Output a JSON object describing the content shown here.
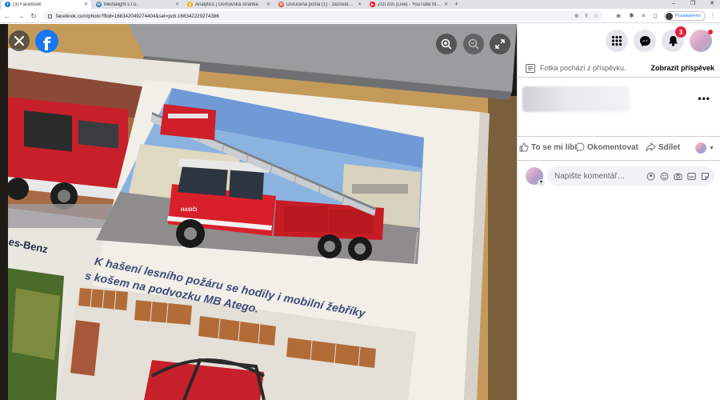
{
  "browser": {
    "tabs": [
      {
        "label": "(3) Facebook",
        "fav_color": "#1877f2",
        "fav_glyph": "f",
        "active": true
      },
      {
        "label": "Medialight s.r.o.",
        "fav_color": "#21759b",
        "fav_glyph": "W",
        "active": false
      },
      {
        "label": "Analytics | Domovská stránka",
        "fav_color": "#f9ab00",
        "fav_glyph": "▮",
        "active": false
      },
      {
        "label": "Doručená pošta (1) - zezovatoz…",
        "fav_color": "#ea4335",
        "fav_glyph": "M",
        "active": false
      },
      {
        "label": "Zrzi zrzi (Live) - YouTube Mu…",
        "fav_color": "#ff0000",
        "fav_glyph": "▶",
        "active": false
      }
    ],
    "url": "facebook.com/photo?fbid=168342049274404&set=pcb.168342229274386",
    "profile_label": "Pozastaveno"
  },
  "viewer": {
    "caption_line1": "K hašení lesního požáru se hodily i mobilní žebříky",
    "caption_line2": "s košem na podvozku MB Atego.",
    "left_text_fragment": "es-Benz",
    "truck_door_text": "HASIČI"
  },
  "panel": {
    "notifications_count": "3",
    "info_text": "Fotka pochází z příspěvku.",
    "view_post_label": "Zobrazit příspěvek",
    "more_label": "•••",
    "like_label": "To se mi líbí",
    "comment_label": "Okomentovat",
    "share_label": "Sdílet",
    "comment_placeholder": "Napište komentář…"
  },
  "colors": {
    "facebook_blue": "#1877f2",
    "badge_red": "#e41e3f",
    "caption_blue": "#3d4a78",
    "truck_red": "#d8202a"
  }
}
